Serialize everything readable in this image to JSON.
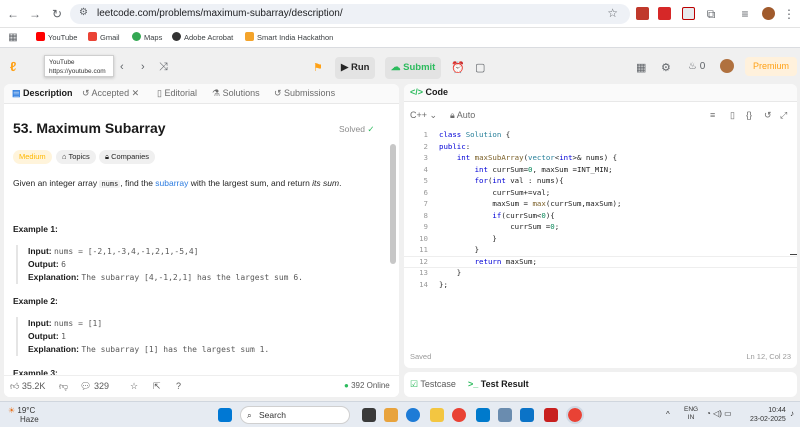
{
  "browser": {
    "url": "leetcode.com/problems/maximum-subarray/description/",
    "bookmarks": [
      "YouTube",
      "Gmail",
      "Maps",
      "Adobe Acrobat",
      "Smart India Hackathon"
    ],
    "tooltip": {
      "title": "YouTube",
      "url": "https://youtube.com"
    }
  },
  "header": {
    "run": "Run",
    "submit": "Submit",
    "streak": "0",
    "premium": "Premium"
  },
  "left_tabs": [
    "Description",
    "Accepted",
    "Editorial",
    "Solutions",
    "Submissions"
  ],
  "problem": {
    "title": "53. Maximum Subarray",
    "status": "Solved",
    "difficulty": "Medium",
    "topics": "Topics",
    "companies": "Companies",
    "desc_pre": "Given an integer array ",
    "desc_code": "nums",
    "desc_mid": ", find the ",
    "desc_link": "subarray",
    "desc_post": " with the largest sum, and return ",
    "desc_em": "its sum",
    "desc_end": ".",
    "examples": [
      {
        "title": "Example 1:",
        "input": "nums = [-2,1,-3,4,-1,2,1,-5,4]",
        "output": "6",
        "explanation": "The subarray [4,-1,2,1] has the largest sum 6."
      },
      {
        "title": "Example 2:",
        "input": "nums = [1]",
        "output": "1",
        "explanation": "The subarray [1] has the largest sum 1."
      }
    ],
    "labels": {
      "input": "Input:",
      "output": "Output:",
      "explanation": "Explanation:"
    },
    "example3_partial": "Example 3:"
  },
  "footer": {
    "likes": "35.2K",
    "comments": "329",
    "online": "392 Online"
  },
  "editor": {
    "tab": "Code",
    "language": "C++",
    "autosave": "Auto",
    "status": "Saved",
    "position": "Ln 12, Col 23",
    "lines": [
      "class Solution {",
      "public:",
      "    int maxSubArray(vector<int>& nums) {",
      "        int currSum=0, maxSum =INT_MIN;",
      "        for(int val : nums){",
      "            currSum+=val;",
      "            maxSum = max(currSum,maxSum);",
      "            if(currSum<0){",
      "                currSum =0;",
      "            }",
      "        }",
      "        return maxSum;",
      "    }",
      "};"
    ]
  },
  "bottom_tabs": {
    "testcase": "Testcase",
    "result": "Test Result"
  },
  "taskbar": {
    "temp": "19°C",
    "weather": "Haze",
    "search": "Search",
    "lang": "ENG",
    "region": "IN",
    "time": "10:44",
    "date": "23-02-2025"
  },
  "colors": {
    "accent": "#ffa116",
    "green": "#2cbb5d",
    "link": "#2b7be0"
  }
}
